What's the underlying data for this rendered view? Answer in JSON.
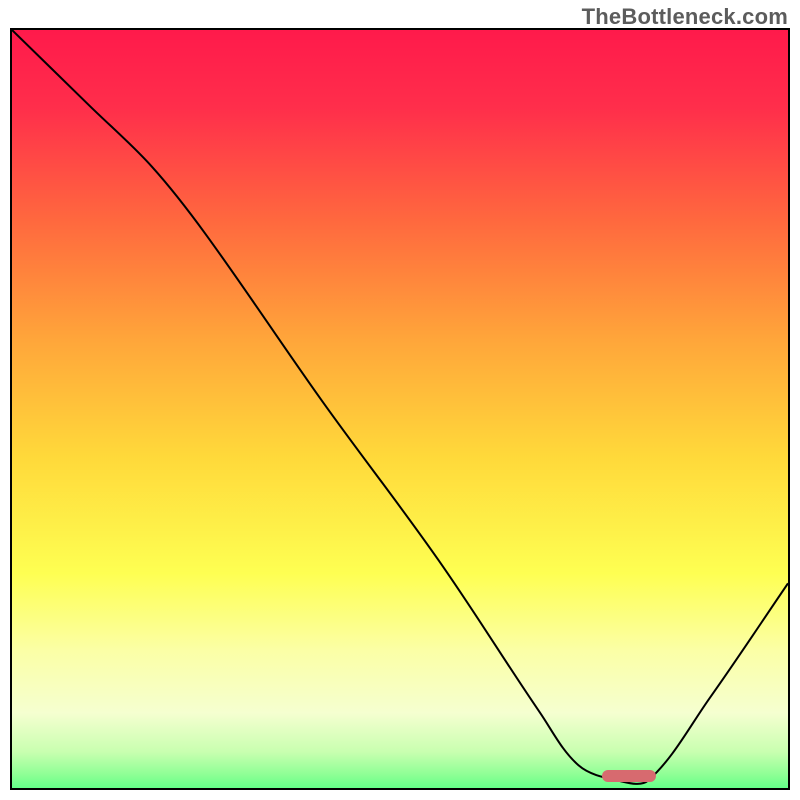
{
  "watermark": "TheBottleneck.com",
  "chart_data": {
    "type": "line",
    "title": "",
    "xlabel": "",
    "ylabel": "",
    "xlim": [
      0,
      100
    ],
    "ylim": [
      0,
      100
    ],
    "grid": false,
    "legend": false,
    "gradient_stops": [
      {
        "pct": 0,
        "color": "#ff1a4b"
      },
      {
        "pct": 10,
        "color": "#ff2e4b"
      },
      {
        "pct": 25,
        "color": "#ff6a3e"
      },
      {
        "pct": 40,
        "color": "#ffa63a"
      },
      {
        "pct": 55,
        "color": "#ffd93a"
      },
      {
        "pct": 70,
        "color": "#feff52"
      },
      {
        "pct": 80,
        "color": "#fbffa6"
      },
      {
        "pct": 88,
        "color": "#f5ffd0"
      },
      {
        "pct": 93,
        "color": "#c9ffb0"
      },
      {
        "pct": 96,
        "color": "#8dff95"
      },
      {
        "pct": 100,
        "color": "#2bff77"
      }
    ],
    "series": [
      {
        "name": "bottleneck-curve",
        "x": [
          0,
          10,
          18,
          25,
          40,
          55,
          68,
          73,
          78,
          82,
          90,
          100
        ],
        "values": [
          100,
          90,
          82,
          73,
          51,
          30,
          10,
          3,
          1,
          1,
          12,
          27
        ]
      }
    ],
    "marker": {
      "x_start": 76,
      "x_end": 83,
      "y": 1,
      "color": "#d76a6f"
    }
  }
}
